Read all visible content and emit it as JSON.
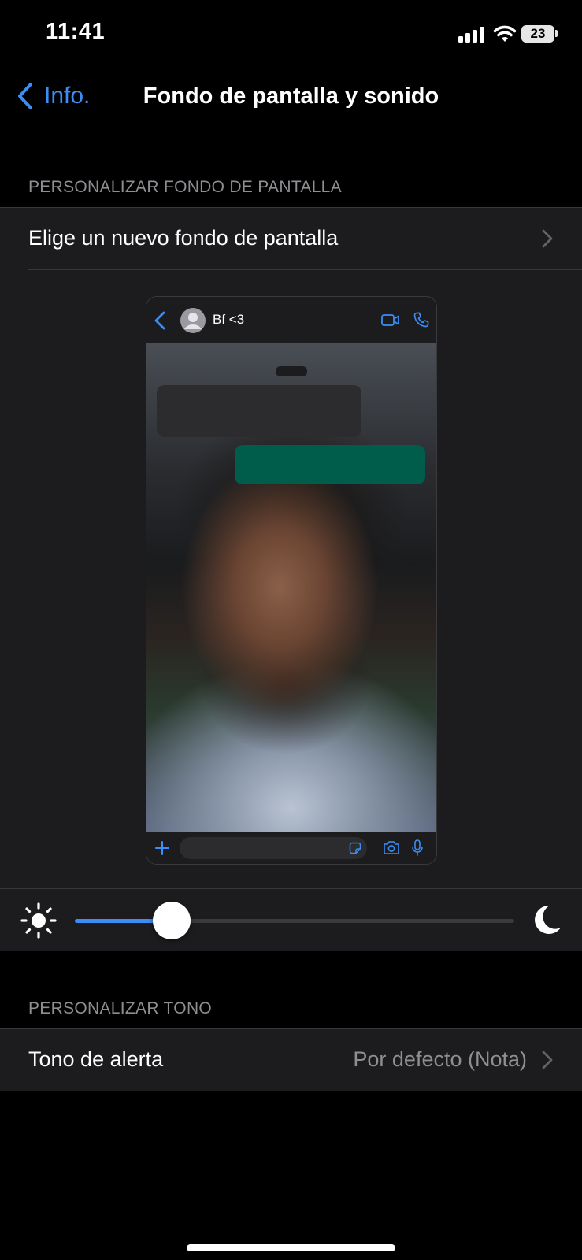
{
  "status_bar": {
    "time": "11:41",
    "battery": "23"
  },
  "nav": {
    "back_label": "Info.",
    "title": "Fondo de pantalla y sonido"
  },
  "wallpaper_section": {
    "header": "PERSONALIZAR FONDO DE PANTALLA",
    "choose_label": "Elige un nuevo fondo de pantalla"
  },
  "preview": {
    "contact_name": "Bf <3",
    "incoming_bubble_color": "#2c2c2e",
    "outgoing_bubble_color": "#005c4b"
  },
  "dimming": {
    "level": 0.22
  },
  "tone_section": {
    "header": "PERSONALIZAR TONO",
    "alert_label": "Tono de alerta",
    "alert_value": "Por defecto (Nota)"
  },
  "colors": {
    "accent": "#3a8ef6",
    "background": "#000000",
    "cell": "#1c1c1e"
  },
  "icons": [
    "signal-icon",
    "wifi-icon",
    "battery-icon",
    "chevron-left-icon",
    "chevron-right-icon",
    "video-icon",
    "phone-icon",
    "plus-icon",
    "sticker-icon",
    "camera-icon",
    "mic-icon",
    "sun-icon",
    "moon-icon"
  ]
}
